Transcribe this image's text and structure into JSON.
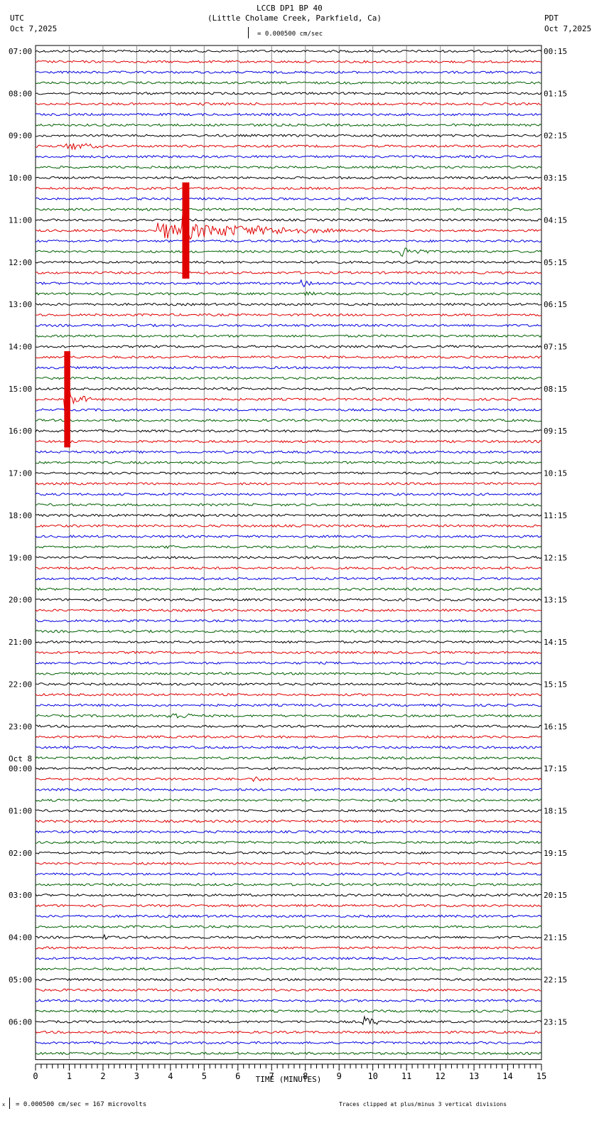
{
  "header": {
    "title": "LCCB DP1 BP 40",
    "subtitle": "(Little Cholame Creek, Parkfield, Ca)",
    "left_tz": "UTC",
    "left_date": "Oct 7,2025",
    "right_tz": "PDT",
    "right_date": "Oct 7,2025",
    "scale": "= 0.000500 cm/sec"
  },
  "footer": {
    "scale_prefix": "x",
    "scale": "= 0.000500 cm/sec =      167 microvolts",
    "clip_note": "Traces clipped at plus/minus 3 vertical divisions"
  },
  "chart_data": {
    "type": "helicorder",
    "xlabel": "TIME (MINUTES)",
    "xlim": [
      0,
      15
    ],
    "x_ticks": [
      "0",
      "1",
      "2",
      "3",
      "4",
      "5",
      "6",
      "7",
      "8",
      "9",
      "10",
      "11",
      "12",
      "13",
      "14",
      "15"
    ],
    "trace_count": 96,
    "trace_minutes": 15,
    "colors": [
      "#000000",
      "#e00000",
      "#0000e0",
      "#006000"
    ],
    "left_labels": [
      "07:00",
      "08:00",
      "09:00",
      "10:00",
      "11:00",
      "12:00",
      "13:00",
      "14:00",
      "15:00",
      "16:00",
      "17:00",
      "18:00",
      "19:00",
      "20:00",
      "21:00",
      "22:00",
      "23:00",
      "00:00",
      "01:00",
      "02:00",
      "03:00",
      "04:00",
      "05:00",
      "06:00"
    ],
    "left_date_change": {
      "label": "Oct 8",
      "before_hour_index": 17
    },
    "right_labels": [
      "00:15",
      "01:15",
      "02:15",
      "03:15",
      "04:15",
      "05:15",
      "06:15",
      "07:15",
      "08:15",
      "09:15",
      "10:15",
      "11:15",
      "12:15",
      "13:15",
      "14:15",
      "15:15",
      "16:15",
      "17:15",
      "18:15",
      "19:15",
      "20:15",
      "21:15",
      "22:15",
      "23:15"
    ],
    "events": [
      {
        "trace": 5,
        "minute": 4.9,
        "amp": 1.2,
        "duration": 1.2
      },
      {
        "trace": 7,
        "minute": 6.4,
        "amp": 1.5,
        "duration": 0.4
      },
      {
        "trace": 9,
        "minute": 0.9,
        "amp": 3,
        "duration": 1.6
      },
      {
        "trace": 17,
        "minute": 3.6,
        "amp": 6,
        "duration": 6.5
      },
      {
        "trace": 17,
        "minute": 4.35,
        "amp": 20,
        "duration": 0.35
      },
      {
        "trace": 19,
        "minute": 10.8,
        "amp": 4,
        "duration": 1.2
      },
      {
        "trace": 22,
        "minute": 7.8,
        "amp": 3,
        "duration": 1.0
      },
      {
        "trace": 23,
        "minute": 8.0,
        "amp": 1.5,
        "duration": 1.0
      },
      {
        "trace": 33,
        "minute": 0.85,
        "amp": 20,
        "duration": 0.3
      },
      {
        "trace": 33,
        "minute": 1.1,
        "amp": 4,
        "duration": 0.8
      },
      {
        "trace": 47,
        "minute": 3.9,
        "amp": 2,
        "duration": 0.5
      },
      {
        "trace": 63,
        "minute": 3.9,
        "amp": 3,
        "duration": 1.3
      },
      {
        "trace": 69,
        "minute": 6.4,
        "amp": 2.5,
        "duration": 0.6
      },
      {
        "trace": 82,
        "minute": 5.2,
        "amp": 1.5,
        "duration": 0.6
      },
      {
        "trace": 84,
        "minute": 2.0,
        "amp": 2,
        "duration": 0.6
      },
      {
        "trace": 92,
        "minute": 9.7,
        "amp": 4,
        "duration": 0.8
      }
    ]
  }
}
